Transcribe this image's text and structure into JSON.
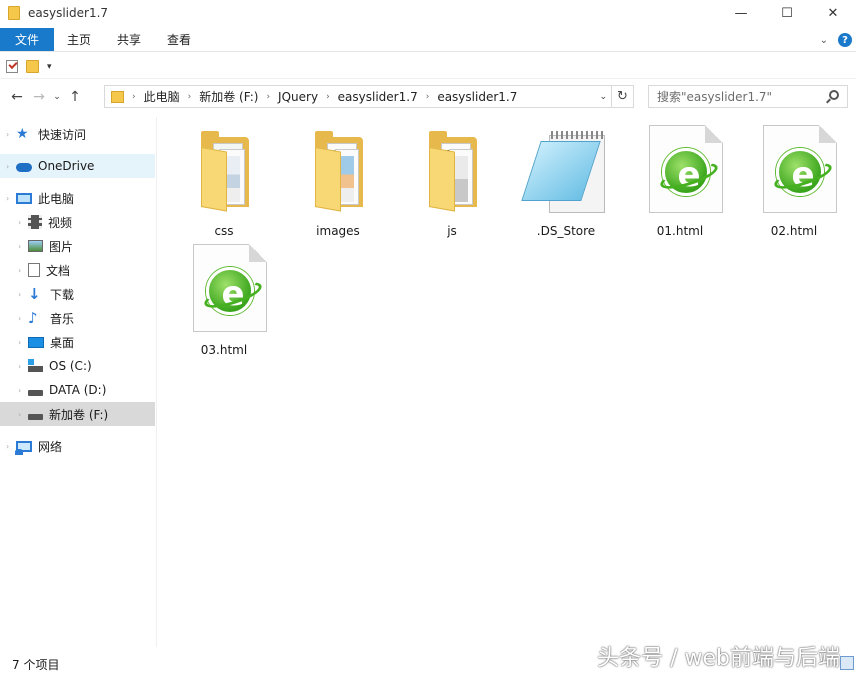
{
  "window": {
    "title": "easyslider1.7",
    "minimize_glyph": "—",
    "maximize_glyph": "☐",
    "close_glyph": "✕"
  },
  "ribbon": {
    "tabs": [
      "文件",
      "主页",
      "共享",
      "查看"
    ],
    "collapse_glyph": "⌄",
    "help_glyph": "?"
  },
  "qat": {
    "dropdown_glyph": "▾"
  },
  "nav": {
    "back_glyph": "←",
    "forward_glyph": "→",
    "recent_glyph": "⌄",
    "up_glyph": "↑",
    "breadcrumb": [
      "此电脑",
      "新加卷 (F:)",
      "JQuery",
      "easyslider1.7",
      "easyslider1.7"
    ],
    "crumb_sep": "›",
    "dropdown_glyph": "⌄",
    "refresh_glyph": "↻",
    "search_placeholder": "搜索\"easyslider1.7\""
  },
  "sidebar": {
    "expander": "›",
    "items": [
      {
        "label": "快速访问",
        "icon": "star-icon"
      },
      {
        "label": "OneDrive",
        "icon": "cloud-icon"
      },
      {
        "label": "此电脑",
        "icon": "pc-icon"
      },
      {
        "label": "视频",
        "icon": "video-icon"
      },
      {
        "label": "图片",
        "icon": "pictures-icon"
      },
      {
        "label": "文档",
        "icon": "documents-icon"
      },
      {
        "label": "下载",
        "icon": "download-icon"
      },
      {
        "label": "音乐",
        "icon": "music-icon"
      },
      {
        "label": "桌面",
        "icon": "desktop-icon"
      },
      {
        "label": "OS (C:)",
        "icon": "os-drive-icon"
      },
      {
        "label": "DATA (D:)",
        "icon": "drive-icon"
      },
      {
        "label": "新加卷 (F:)",
        "icon": "drive-icon"
      },
      {
        "label": "网络",
        "icon": "network-icon"
      }
    ]
  },
  "files": [
    {
      "name": "css",
      "type": "folder"
    },
    {
      "name": "images",
      "type": "folder"
    },
    {
      "name": "js",
      "type": "folder"
    },
    {
      "name": ".DS_Store",
      "type": "notepad"
    },
    {
      "name": "01.html",
      "type": "html"
    },
    {
      "name": "02.html",
      "type": "html"
    },
    {
      "name": "03.html",
      "type": "html"
    }
  ],
  "status": {
    "item_count": "7 个项目"
  },
  "watermark": "头条号 / web前端与后端",
  "html_icon_letter": "e",
  "colors": {
    "accent": "#1979ca",
    "folder": "#e7b84b",
    "html_green": "#3aa51c"
  }
}
